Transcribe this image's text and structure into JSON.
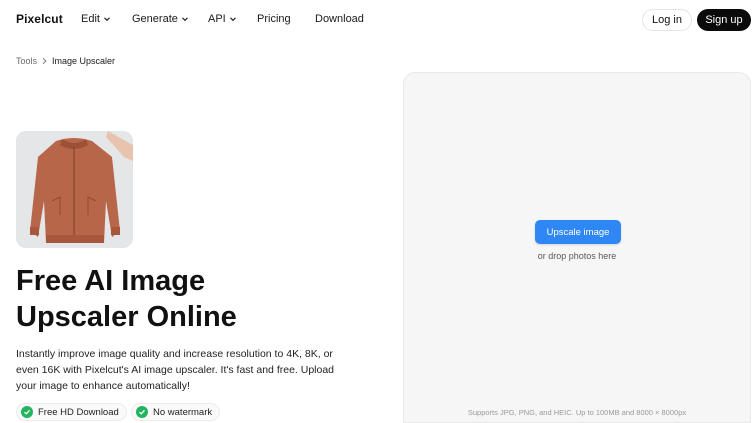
{
  "nav": {
    "logo": "Pixelcut",
    "items": [
      {
        "label": "Edit",
        "has_dropdown": true
      },
      {
        "label": "Generate",
        "has_dropdown": true
      },
      {
        "label": "API",
        "has_dropdown": true
      },
      {
        "label": "Pricing",
        "has_dropdown": false
      },
      {
        "label": "Download",
        "has_dropdown": false
      }
    ],
    "login_label": "Log in",
    "signup_label": "Sign up"
  },
  "breadcrumb": {
    "parent": "Tools",
    "separator_icon": "chevron-right-icon",
    "current": "Image Upscaler"
  },
  "hero": {
    "image_icon": "jacket-photo",
    "title_line1": "Free AI Image",
    "title_line2": "Upscaler Online",
    "description": "Instantly improve image quality and increase resolution to 4K, 8K, or even 16K with Pixelcut's AI image upscaler. It's fast and free. Upload your image to enhance automatically!",
    "badges": [
      {
        "label": "Free HD Download",
        "icon": "check-circle-icon"
      },
      {
        "label": "No watermark",
        "icon": "check-circle-icon"
      }
    ]
  },
  "upload": {
    "button_label": "Upscale image",
    "drop_text": "or drop photos here",
    "supports_text": "Supports JPG, PNG, and HEIC. Up to 100MB and 8000 × 8000px"
  },
  "colors": {
    "accent": "#2f86f5",
    "signup_bg": "#0b0b0b",
    "check_green": "#22b45e",
    "panel_bg": "#f6f6f6"
  }
}
